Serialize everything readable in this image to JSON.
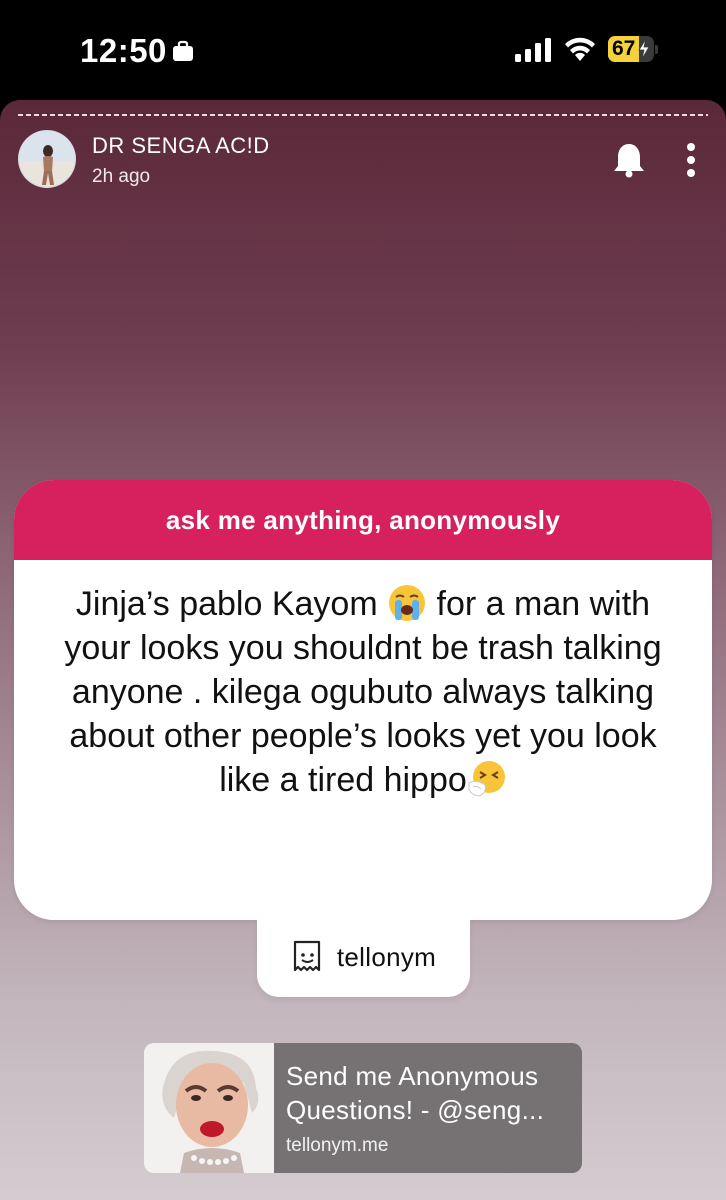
{
  "status_bar": {
    "time": "12:50",
    "battery_level": "67",
    "battery_charging": true,
    "battery_color": "#f4d23c"
  },
  "story": {
    "progress_segments": 1,
    "user": {
      "name": "DR SENGA AC!D",
      "posted": "2h ago"
    },
    "question_card": {
      "header": "ask me anything, anonymously",
      "header_color": "#d6215e",
      "text_part1": "Jinja’s pablo Kayom ",
      "emoji1": "loudly-crying-face",
      "text_part2": " for a man with your looks you shouldnt be trash talking anyone . kilega ogubuto always talking about other people’s looks yet you look like a tired hippo",
      "emoji2": "sneezing-face"
    },
    "brand": {
      "name": "tellonym"
    },
    "link": {
      "title": "Send me Anonymous Questions! - @seng...",
      "domain": "tellonym.me"
    }
  }
}
